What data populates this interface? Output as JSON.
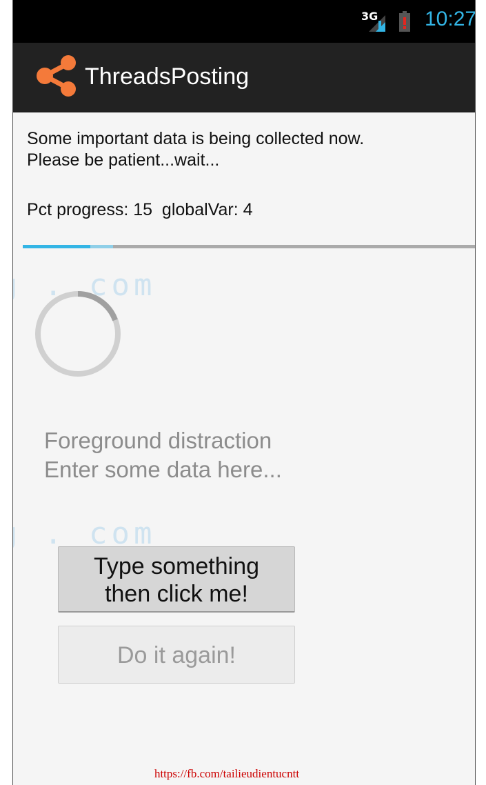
{
  "statusbar": {
    "network": "3G",
    "time": "10:27",
    "icons": [
      "signal-icon",
      "battery-low-icon"
    ]
  },
  "actionbar": {
    "icon": "share-icon",
    "title": "ThreadsPosting"
  },
  "main": {
    "message_line1": "Some important data is being collected now.",
    "message_line2": "Please be patient...wait...",
    "progress_text": "Pct progress: 15  globalVar: 4",
    "progress_percent": 15,
    "edit_line1": "Foreground distraction",
    "edit_line2": "Enter some data here...",
    "watermark": "g . com",
    "watermark2": "g . com"
  },
  "buttons": {
    "primary_line1": "Type something",
    "primary_line2": "then click me!",
    "secondary": "Do it again!"
  },
  "footer": {
    "link": "https://fb.com/tailieudientucntt"
  },
  "colors": {
    "accent": "#33b5e5",
    "actionbar": "#222222",
    "app_icon": "#f47a3a",
    "footer": "#cc0000"
  }
}
